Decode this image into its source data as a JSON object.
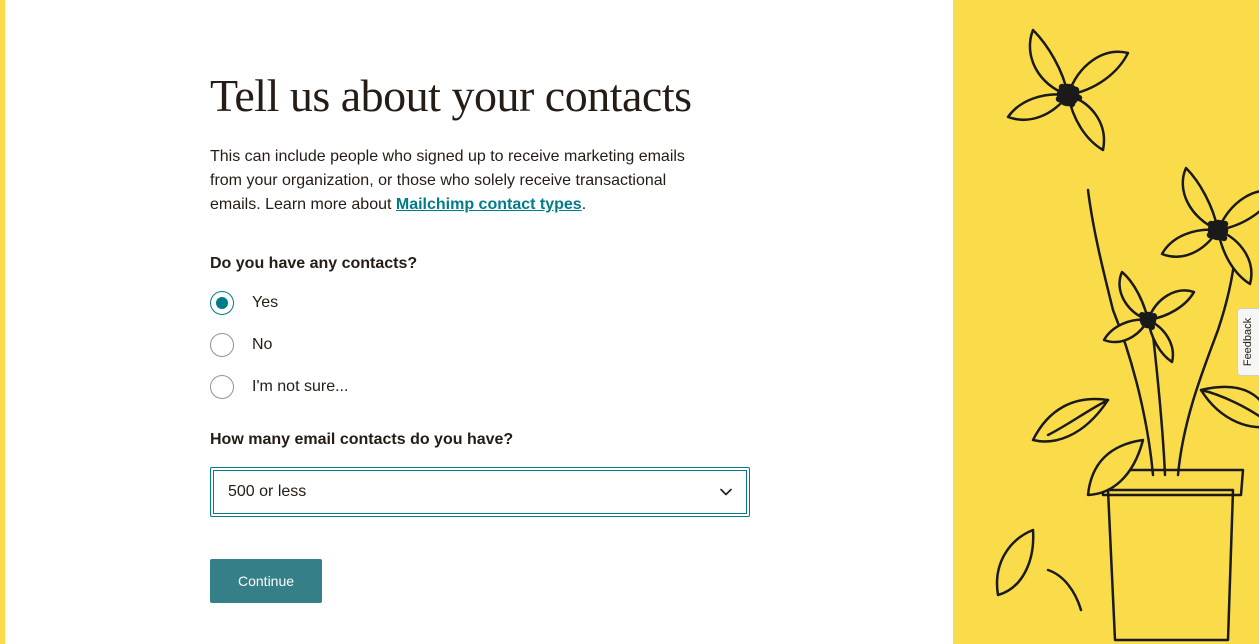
{
  "heading": "Tell us about your contacts",
  "subtext_before": "This can include people who signed up to receive marketing emails from your organization, or those who solely receive transactional emails. Learn more about ",
  "subtext_link": "Mailchimp contact types",
  "subtext_after": ".",
  "question1": {
    "label": "Do you have any contacts?",
    "options": [
      {
        "label": "Yes",
        "selected": true
      },
      {
        "label": "No",
        "selected": false
      },
      {
        "label": "I'm not sure...",
        "selected": false
      }
    ]
  },
  "question2": {
    "label": "How many email contacts do you have?",
    "selected_value": "500 or less"
  },
  "continue_label": "Continue",
  "feedback_label": "Feedback",
  "colors": {
    "accent": "#007c89",
    "yellow": "#fadc4a",
    "button_bg": "#347f88"
  }
}
